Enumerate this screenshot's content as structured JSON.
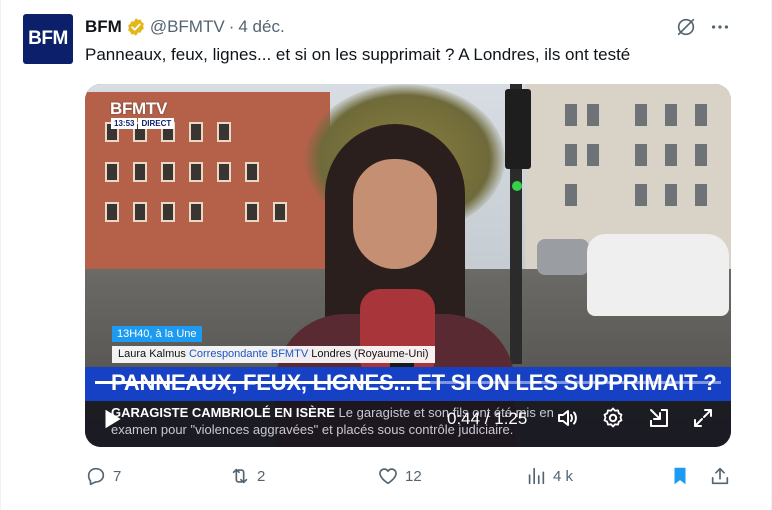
{
  "tweet": {
    "author_name": "BFM",
    "handle": "@BFMTV",
    "separator": "·",
    "date": "4 déc.",
    "text": "Panneaux, feux, lignes... et si on les supprimait ? A Londres, ils ont testé",
    "avatar_text": "BFM"
  },
  "video": {
    "channel_logo": "BFMTV",
    "clock_time": "13:53",
    "clock_label": "DIRECT",
    "show_tag": "13H40, à la Une",
    "reporter_name": "Laura Kalmus",
    "reporter_role": "Correspondante BFMTV",
    "reporter_location": "Londres (Royaume-Uni)",
    "headline": "PANNEAUX, FEUX, LIGNES... ET SI ON LES SUPPRIMAIT ?",
    "ticker_title": "GARAGISTE CAMBRIOLÉ EN ISÈRE",
    "ticker_line1": "Le garagiste et son fils ont été mis en",
    "ticker_line2": "examen pour \"violences aggravées\" et placés sous contrôle judiciaire.",
    "time_display": "0:44 / 1:25",
    "progress_fraction": 0.52,
    "controls": [
      "play-icon",
      "volume-icon",
      "settings-icon",
      "pip-icon",
      "fullscreen-icon"
    ]
  },
  "actions": {
    "replies": "7",
    "reposts": "2",
    "likes": "12",
    "views": "4 k"
  },
  "colors": {
    "bfm_blue": "#0b1f6b",
    "verified_gold": "#e2b719",
    "headline_blue": "#1741c4",
    "bookmark_blue": "#1d9bf0",
    "muted": "#536471"
  }
}
